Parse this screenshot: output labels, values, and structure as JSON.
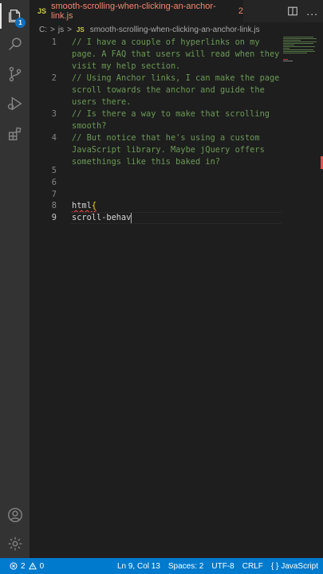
{
  "colors": {
    "accent": "#007acc",
    "comment": "#6a9955",
    "error": "#f14c4c",
    "tab_error_text": "#f48771",
    "js_icon": "#cbcb41"
  },
  "activity_bar": {
    "icons": [
      "files-icon",
      "search-icon",
      "source-control-icon",
      "run-debug-icon",
      "extensions-icon",
      "account-icon",
      "settings-gear-icon"
    ],
    "explorer_badge": "1"
  },
  "tab": {
    "icon_text": "JS",
    "filename": "smooth-scrolling-when-clicking-an-anchor-link.js",
    "problem_count": "2",
    "more": "..."
  },
  "breadcrumb": {
    "drive": "C:",
    "sep1": ">",
    "folder": "js",
    "sep2": ">",
    "icon_text": "JS",
    "file": "smooth-scrolling-when-clicking-an-anchor-link.js"
  },
  "editor": {
    "lines": [
      {
        "num": "1",
        "text": "// I have a couple of hyperlinks on my"
      },
      {
        "num": "",
        "text": "page. A FAQ that users will read when they"
      },
      {
        "num": "",
        "text": "visit my help section."
      },
      {
        "num": "2",
        "text": "// Using Anchor links, I can make the page"
      },
      {
        "num": "",
        "text": "scroll towards the anchor and guide the"
      },
      {
        "num": "",
        "text": "users there."
      },
      {
        "num": "3",
        "text": "// Is there a way to make that scrolling"
      },
      {
        "num": "",
        "text": "smooth?"
      },
      {
        "num": "4",
        "text": "// But notice that he's using a custom"
      },
      {
        "num": "",
        "text": "JavaScript library. Maybe jQuery offers"
      },
      {
        "num": "",
        "text": "somethings like this baked in?"
      },
      {
        "num": "5",
        "text": ""
      },
      {
        "num": "6",
        "text": ""
      },
      {
        "num": "7",
        "text": ""
      },
      {
        "num": "8",
        "text": "html",
        "brace": "{"
      },
      {
        "num": "9",
        "text": "scroll-behav"
      }
    ]
  },
  "status_bar": {
    "errors": "2",
    "warnings": "0",
    "position": "Ln 9, Col 13",
    "spaces": "Spaces: 2",
    "encoding": "UTF-8",
    "eol": "CRLF",
    "language_icon": "{ }",
    "language": "JavaScript"
  }
}
